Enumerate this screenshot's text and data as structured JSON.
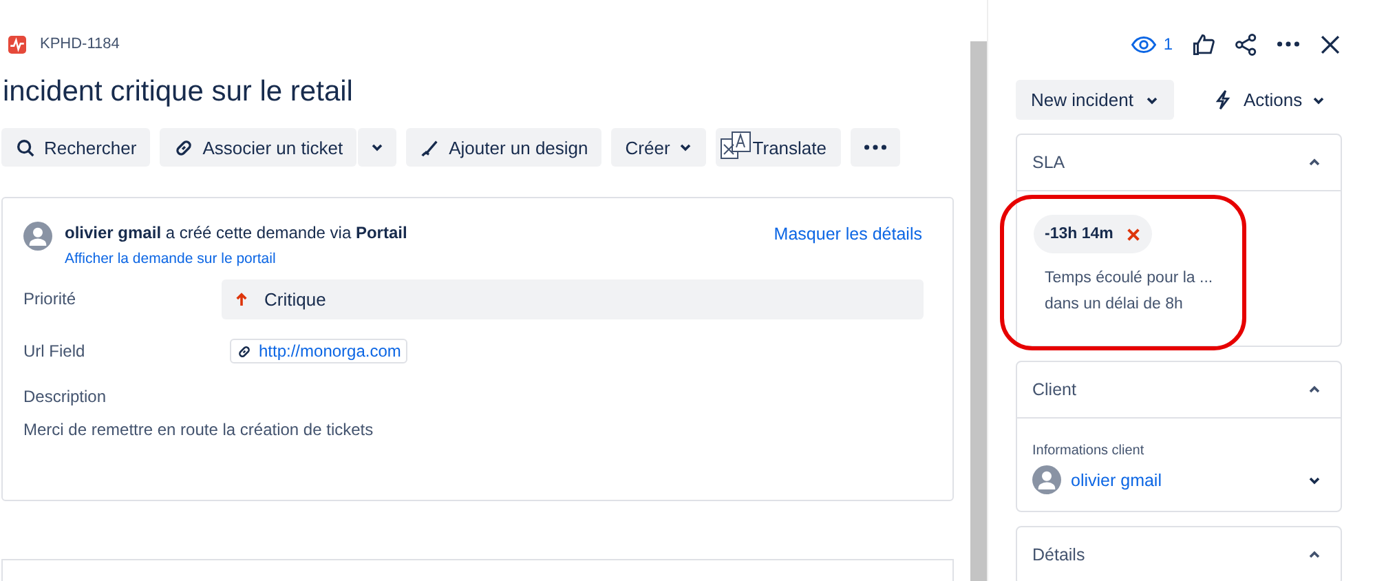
{
  "issue": {
    "key": "KPHD-1184",
    "title": "incident critique sur le retail"
  },
  "toolbar": [
    {
      "label": "Rechercher",
      "kind": "search"
    },
    {
      "label": "Associer un ticket",
      "kind": "link-split"
    },
    {
      "label": "Ajouter un design",
      "kind": "design"
    },
    {
      "label": "Créer",
      "kind": "dropdown"
    },
    {
      "label": "Translate",
      "kind": "translate"
    },
    {
      "kind": "more"
    }
  ],
  "request": {
    "author": "olivier gmail",
    "action": " a créé cette demande via ",
    "channel": "Portail",
    "portal_link": "Afficher la demande sur le portail",
    "toggle": "Masquer les détails"
  },
  "fields": [
    {
      "label": "Priorité",
      "kind": "priority",
      "value": "Critique"
    },
    {
      "label": "Url Field",
      "kind": "url",
      "value": "http://monorga.com"
    }
  ],
  "description": {
    "label": "Description",
    "text": "Merci de remettre en route la création de tickets"
  },
  "header_actions": {
    "watchers": "1"
  },
  "status": {
    "label": "New incident"
  },
  "actions": {
    "label": "Actions"
  },
  "sections": [
    {
      "title": "SLA",
      "kind": "sla",
      "expanded": true,
      "time": "-13h 14m",
      "breached": true,
      "lines": [
        "Temps écoulé pour la ...",
        "dans un délai de 8h"
      ]
    },
    {
      "title": "Client",
      "kind": "client",
      "expanded": true,
      "field_label": "Informations client",
      "client": "olivier gmail"
    },
    {
      "title": "Détails",
      "kind": "details",
      "expanded": true
    }
  ]
}
